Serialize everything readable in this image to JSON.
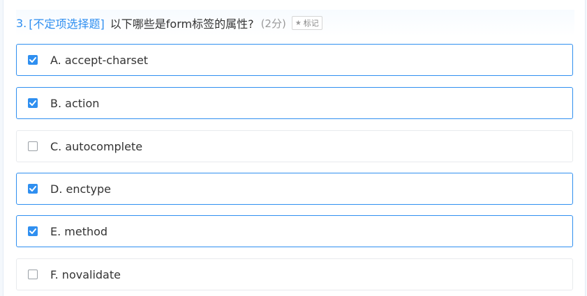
{
  "question": {
    "number": "3.",
    "type": "[不定项选择题]",
    "text": "以下哪些是form标签的属性?",
    "score": "(2分)",
    "mark_icon": "star-icon",
    "mark_label": "标记"
  },
  "options": [
    {
      "label": "A. accept-charset",
      "checked": true
    },
    {
      "label": "B. action",
      "checked": true
    },
    {
      "label": "C. autocomplete",
      "checked": false
    },
    {
      "label": "D. enctype",
      "checked": true
    },
    {
      "label": "E. method",
      "checked": true
    },
    {
      "label": "F. novalidate",
      "checked": false
    }
  ],
  "colors": {
    "accent": "#2f8ff0",
    "text": "#333333",
    "muted": "#9a9a9a"
  }
}
